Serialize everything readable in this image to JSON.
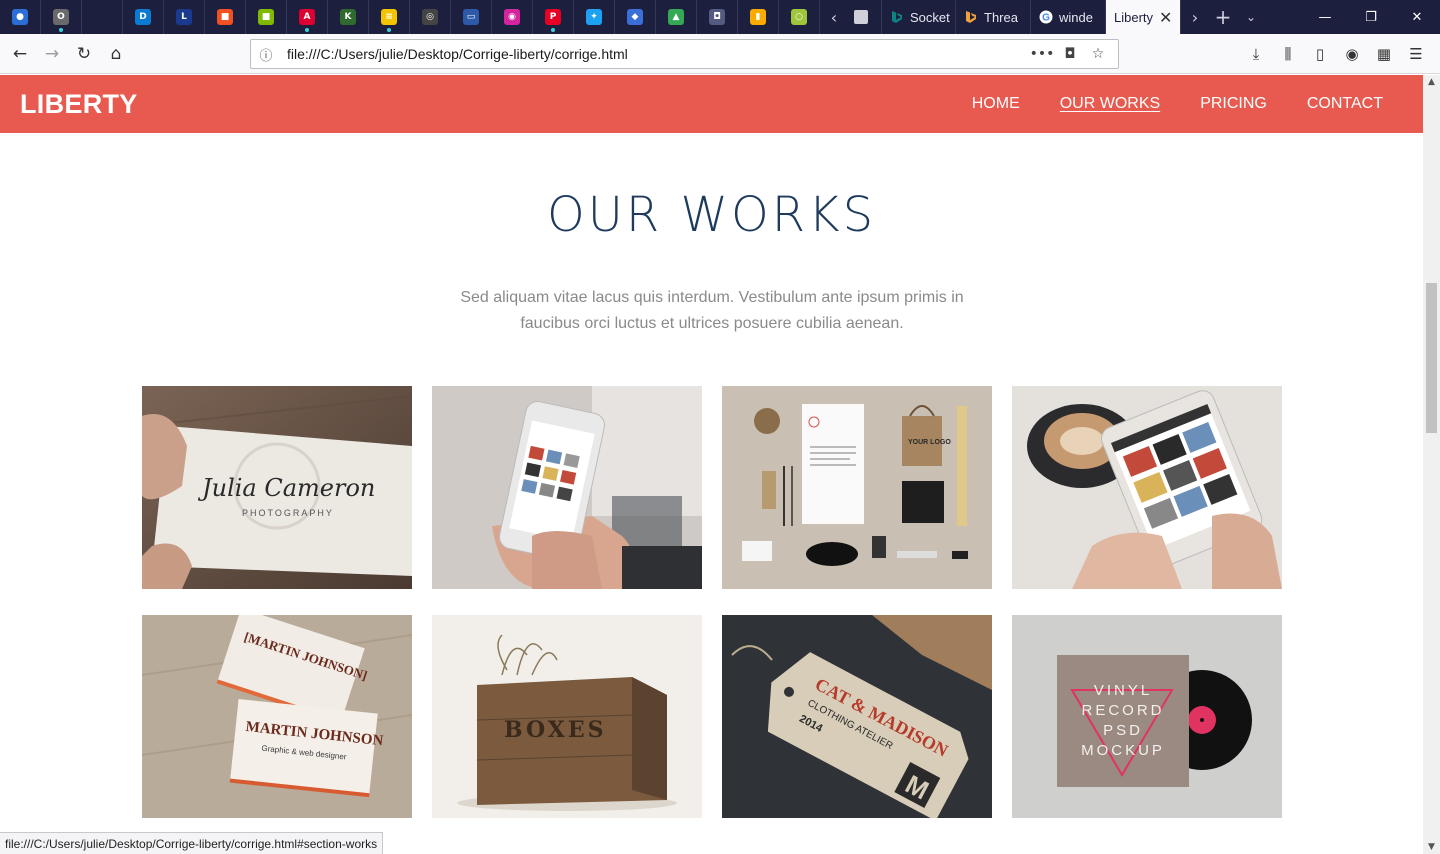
{
  "browser": {
    "pinned_tabs": [
      {
        "icon": "app-icon-1",
        "color": "#2b6fd6",
        "glyph": "●"
      },
      {
        "icon": "app-icon-2",
        "color": "#6a6a6a",
        "glyph": "O"
      },
      {
        "icon": "blank-tab-icon",
        "color": "#1d1f3f",
        "glyph": ""
      },
      {
        "icon": "dashlane-icon",
        "color": "#0b7bd1",
        "glyph": "D"
      },
      {
        "icon": "ldlc-icon",
        "color": "#1a3a8f",
        "glyph": "L"
      },
      {
        "icon": "microsoft-icon",
        "color": "#f25022",
        "glyph": "■"
      },
      {
        "icon": "microsoft-store-icon",
        "color": "#7fba00",
        "glyph": "■"
      },
      {
        "icon": "angular-icon",
        "color": "#dd0031",
        "glyph": "A"
      },
      {
        "icon": "kle-icon",
        "color": "#2f6b2f",
        "glyph": "K"
      },
      {
        "icon": "stack-icon",
        "color": "#f5c400",
        "glyph": "≡"
      },
      {
        "icon": "globe-icon",
        "color": "#444444",
        "glyph": "◎"
      },
      {
        "icon": "screen-icon",
        "color": "#2d5aa8",
        "glyph": "▭"
      },
      {
        "icon": "instagram-icon",
        "color": "#d6249f",
        "glyph": "◉"
      },
      {
        "icon": "pinterest-icon",
        "color": "#e60023",
        "glyph": "P"
      },
      {
        "icon": "twitter-icon",
        "color": "#1da1f2",
        "glyph": "✦"
      },
      {
        "icon": "bookmark-app-icon",
        "color": "#3b6fd8",
        "glyph": "◆"
      },
      {
        "icon": "drive-icon",
        "color": "#34a853",
        "glyph": "▲"
      },
      {
        "icon": "bag-icon",
        "color": "#555a80",
        "glyph": "◘"
      },
      {
        "icon": "analytics-icon",
        "color": "#f9ab00",
        "glyph": "▮"
      },
      {
        "icon": "circle-app-icon",
        "color": "#9fc63a",
        "glyph": "○"
      }
    ],
    "tabs": [
      {
        "label": "Socket",
        "icon": "bing-icon"
      },
      {
        "label": "Threa",
        "icon": "bing-icon"
      },
      {
        "label": "winde",
        "icon": "google-icon"
      }
    ],
    "active_tab": {
      "label": "Liberty"
    },
    "url": "file:///C:/Users/julie/Desktop/Corrige-liberty/corrige.html",
    "status_link": "file:///C:/Users/julie/Desktop/Corrige-liberty/corrige.html#section-works"
  },
  "site": {
    "logo": "LIBERTY",
    "brand_color": "#e85a4f",
    "nav": [
      {
        "label": "HOME",
        "current": false
      },
      {
        "label": "OUR WORKS",
        "current": true
      },
      {
        "label": "PRICING",
        "current": false
      },
      {
        "label": "CONTACT",
        "current": false
      }
    ]
  },
  "works": {
    "title": "OUR WORKS",
    "lead_line1": "Sed aliquam vitae lacus quis interdum. Vestibulum ante ipsum primis in",
    "lead_line2": "faucibus orci luctus et ultrices posuere cubilia aenean.",
    "items": [
      {
        "name": "julia-cameron-card",
        "card_text": "Julia Cameron",
        "card_sub": "PHOTOGRAPHY"
      },
      {
        "name": "iphone-mockup"
      },
      {
        "name": "stationery-mockup",
        "bag_text": "YOUR LOGO"
      },
      {
        "name": "android-phone-mockup"
      },
      {
        "name": "martin-johnson-cards",
        "card_text": "MARTIN JOHNSON",
        "card_sub": "Graphic & web designer"
      },
      {
        "name": "boxes-crate",
        "crate_text": "BOXES"
      },
      {
        "name": "cat-madison-tag",
        "tag_text": "CAT & MADISON",
        "tag_sub": "CLOTHING ATELIER",
        "tag_year": "2014",
        "tag_letter": "M"
      },
      {
        "name": "vinyl-record-mockup",
        "cover_text_1": "VINYL",
        "cover_text_2": "RECORD",
        "cover_text_3": "PSD",
        "cover_text_4": "MOCKUP"
      }
    ]
  }
}
